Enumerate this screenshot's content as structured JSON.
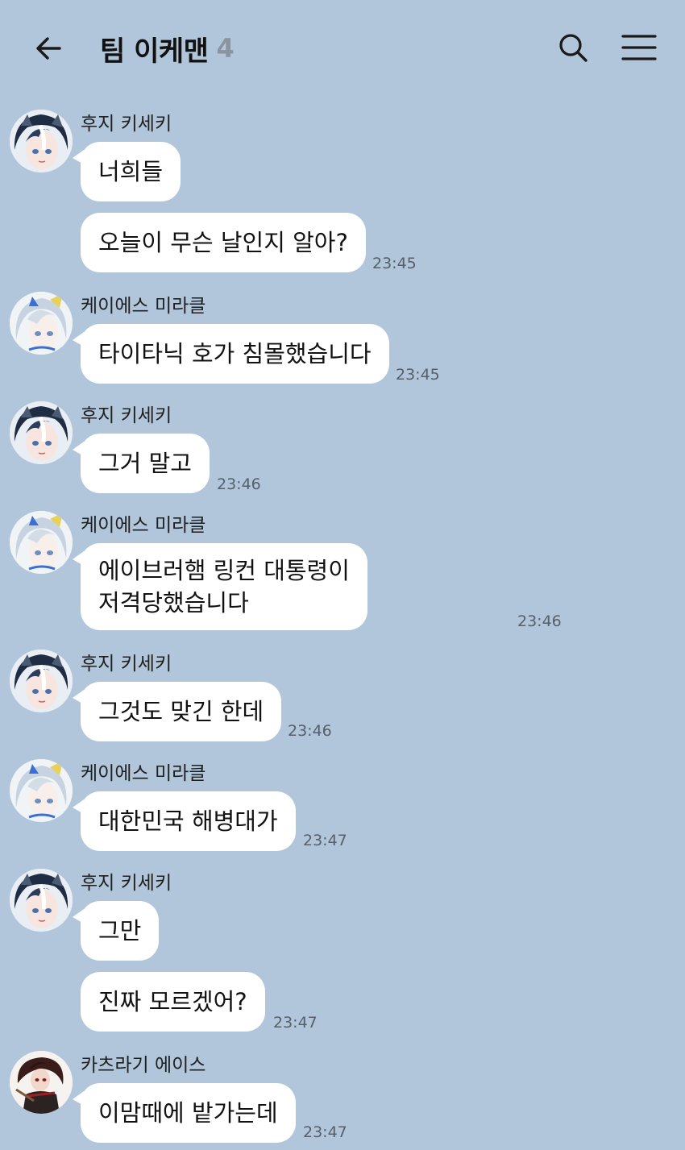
{
  "header": {
    "title": "팀 이케맨",
    "member_count": "4",
    "icons": {
      "back": "back-arrow-icon",
      "search": "search-icon",
      "menu": "hamburger-menu-icon"
    }
  },
  "colors": {
    "background": "#b1c6da",
    "bubble": "#ffffff",
    "time": "#55606b",
    "member_count": "#8a949e"
  },
  "messages": [
    {
      "sender": "후지 키세키",
      "avatar": "fuji-kiseki-avatar",
      "bubbles": [
        {
          "text": "너희들",
          "time": ""
        },
        {
          "text": "오늘이 무슨 날인지 알아?",
          "time": "23:45"
        }
      ]
    },
    {
      "sender": "케이에스 미라클",
      "avatar": "ks-miracle-avatar",
      "bubbles": [
        {
          "text": "타이타닉 호가 침몰했습니다",
          "time": "23:45"
        }
      ]
    },
    {
      "sender": "후지 키세키",
      "avatar": "fuji-kiseki-avatar",
      "bubbles": [
        {
          "text": "그거 말고",
          "time": "23:46"
        }
      ]
    },
    {
      "sender": "케이에스 미라클",
      "avatar": "ks-miracle-avatar",
      "bubbles": [
        {
          "line1": "에이브러햄 링컨 대통령이",
          "line2": "저격당했습니다",
          "time": "23:46"
        }
      ]
    },
    {
      "sender": "후지 키세키",
      "avatar": "fuji-kiseki-avatar",
      "bubbles": [
        {
          "text": "그것도 맞긴 한데",
          "time": "23:46"
        }
      ]
    },
    {
      "sender": "케이에스 미라클",
      "avatar": "ks-miracle-avatar",
      "bubbles": [
        {
          "text": "대한민국 해병대가",
          "time": "23:47"
        }
      ]
    },
    {
      "sender": "후지 키세키",
      "avatar": "fuji-kiseki-avatar",
      "bubbles": [
        {
          "text": "그만",
          "time": ""
        },
        {
          "text": "진짜 모르겠어?",
          "time": "23:47"
        }
      ]
    },
    {
      "sender": "카츠라기 에이스",
      "avatar": "katsuragi-ace-avatar",
      "bubbles": [
        {
          "text": "이맘때에 밭가는데",
          "time": "23:47"
        }
      ]
    }
  ]
}
